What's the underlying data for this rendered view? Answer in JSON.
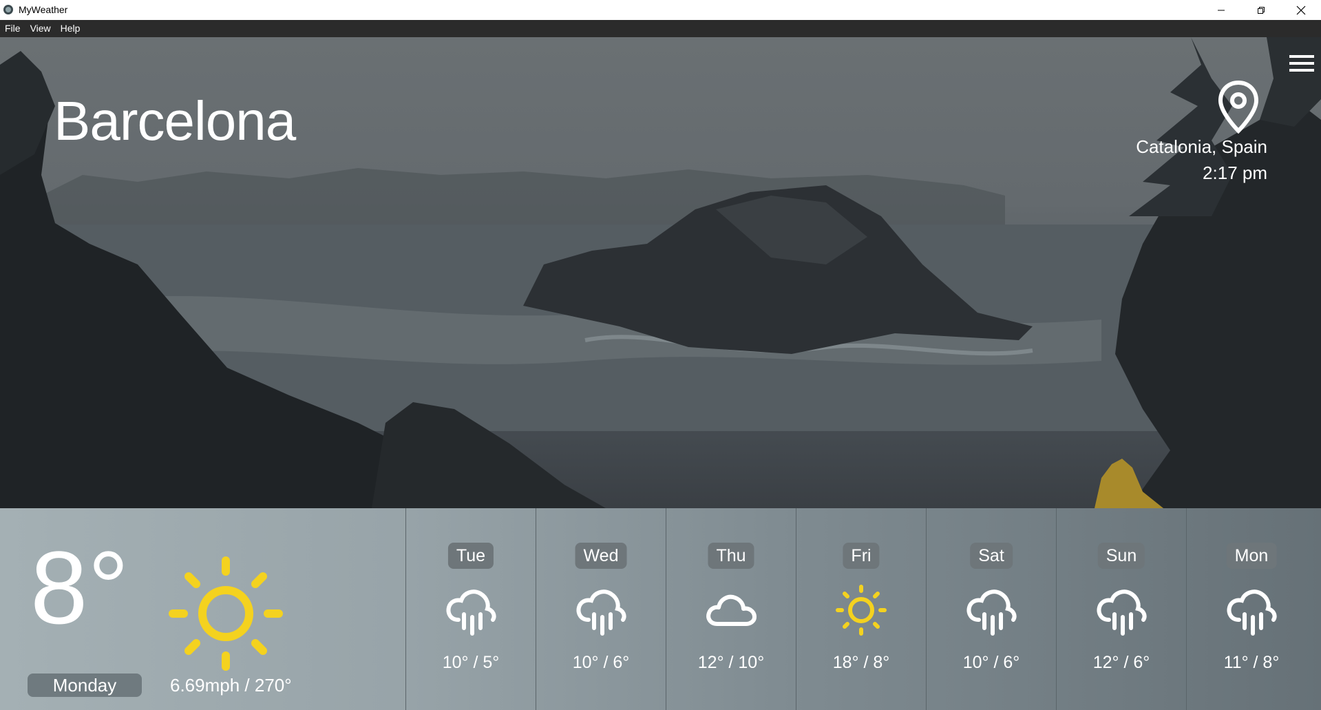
{
  "window": {
    "title": "MyWeather",
    "controls": [
      "minimize-icon",
      "restore-icon",
      "close-icon"
    ]
  },
  "menu": [
    "File",
    "View",
    "Help"
  ],
  "location": {
    "city": "Barcelona",
    "region": "Catalonia, Spain",
    "time": "2:17 pm"
  },
  "current": {
    "temperature": "8°",
    "day": "Monday",
    "wind": "6.69mph / 270°",
    "icon": "sun-icon"
  },
  "forecast": [
    {
      "day": "Tue",
      "temps": "10° / 5°",
      "icon": "rain-icon"
    },
    {
      "day": "Wed",
      "temps": "10° / 6°",
      "icon": "rain-icon"
    },
    {
      "day": "Thu",
      "temps": "12° / 10°",
      "icon": "cloud-icon"
    },
    {
      "day": "Fri",
      "temps": "18° / 8°",
      "icon": "sun-icon"
    },
    {
      "day": "Sat",
      "temps": "10° / 6°",
      "icon": "rain-icon"
    },
    {
      "day": "Sun",
      "temps": "12° / 6°",
      "icon": "rain-icon"
    },
    {
      "day": "Mon",
      "temps": "11° / 8°",
      "icon": "rain-icon"
    }
  ],
  "colors": {
    "sun": "#F4D21F",
    "menubar": "#2B2B2B",
    "pill": "#6E767A"
  }
}
